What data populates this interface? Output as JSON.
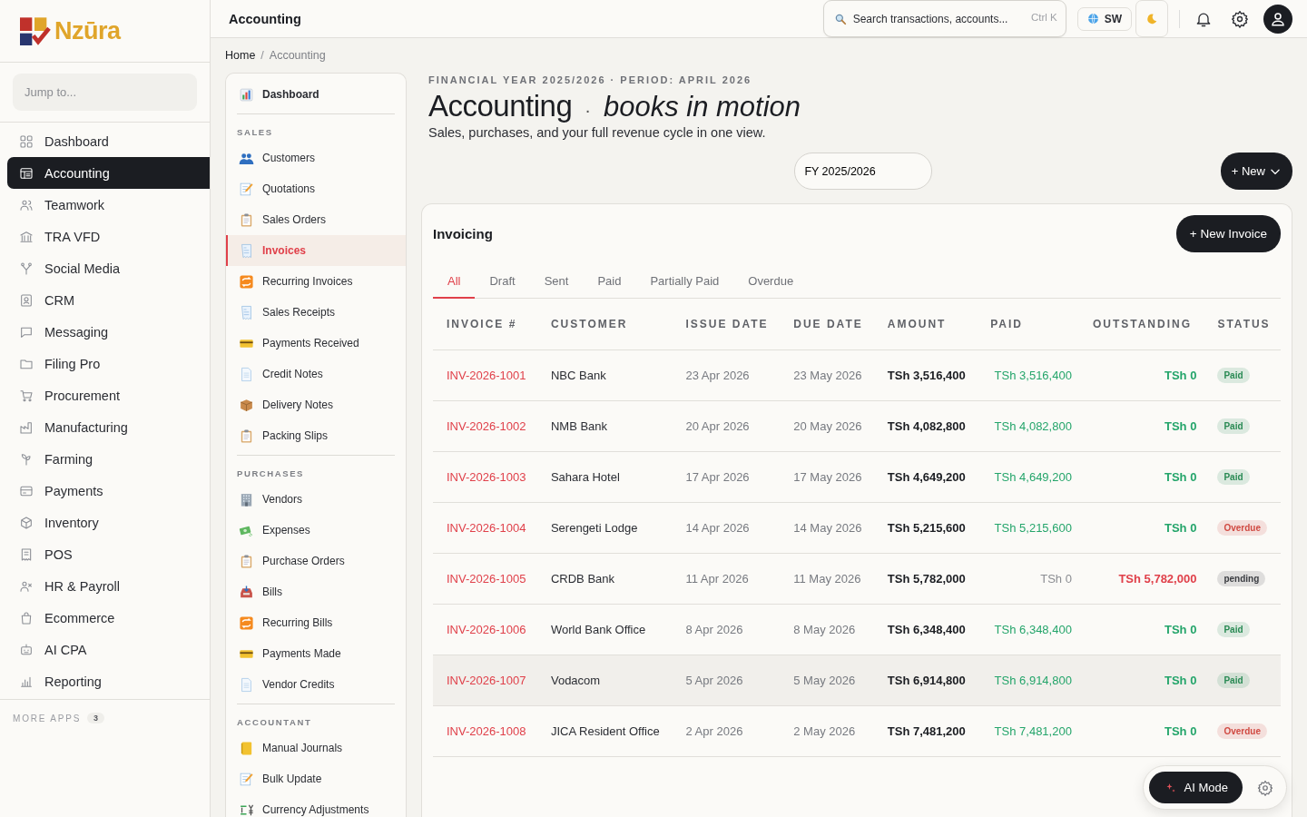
{
  "brand": {
    "name": "Nzūra"
  },
  "sidebar": {
    "search_placeholder": "Jump to...",
    "items": [
      {
        "label": "Dashboard",
        "selected": false
      },
      {
        "label": "Accounting",
        "selected": true
      },
      {
        "label": "Teamwork",
        "selected": false
      },
      {
        "label": "TRA VFD",
        "selected": false
      },
      {
        "label": "Social Media",
        "selected": false
      },
      {
        "label": "CRM",
        "selected": false
      },
      {
        "label": "Messaging",
        "selected": false
      },
      {
        "label": "Filing Pro",
        "selected": false
      },
      {
        "label": "Procurement",
        "selected": false
      },
      {
        "label": "Manufacturing",
        "selected": false
      },
      {
        "label": "Farming",
        "selected": false
      },
      {
        "label": "Payments",
        "selected": false
      },
      {
        "label": "Inventory",
        "selected": false
      },
      {
        "label": "POS",
        "selected": false
      },
      {
        "label": "HR & Payroll",
        "selected": false
      },
      {
        "label": "Ecommerce",
        "selected": false
      },
      {
        "label": "AI CPA",
        "selected": false
      },
      {
        "label": "Reporting",
        "selected": false
      }
    ],
    "more_apps": {
      "label": "MORE APPS",
      "count": "3"
    }
  },
  "header": {
    "title": "Accounting",
    "search_placeholder": "Search transactions, accounts...",
    "shortcut": "Ctrl K",
    "language": "SW"
  },
  "breadcrumb": {
    "items": [
      "Home",
      "Accounting"
    ],
    "separator": "/"
  },
  "subnav": {
    "top": {
      "label": "Dashboard",
      "selected": false
    },
    "sections": [
      {
        "title": "SALES",
        "items": [
          {
            "label": "Customers",
            "selected": false
          },
          {
            "label": "Quotations",
            "selected": false
          },
          {
            "label": "Sales Orders",
            "selected": false
          },
          {
            "label": "Invoices",
            "selected": true
          },
          {
            "label": "Recurring Invoices",
            "selected": false
          },
          {
            "label": "Sales Receipts",
            "selected": false
          },
          {
            "label": "Payments Received",
            "selected": false
          },
          {
            "label": "Credit Notes",
            "selected": false
          },
          {
            "label": "Delivery Notes",
            "selected": false
          },
          {
            "label": "Packing Slips",
            "selected": false
          }
        ]
      },
      {
        "title": "PURCHASES",
        "items": [
          {
            "label": "Vendors",
            "selected": false
          },
          {
            "label": "Expenses",
            "selected": false
          },
          {
            "label": "Purchase Orders",
            "selected": false
          },
          {
            "label": "Bills",
            "selected": false
          },
          {
            "label": "Recurring Bills",
            "selected": false
          },
          {
            "label": "Payments Made",
            "selected": false
          },
          {
            "label": "Vendor Credits",
            "selected": false
          }
        ]
      },
      {
        "title": "ACCOUNTANT",
        "items": [
          {
            "label": "Manual Journals",
            "selected": false
          },
          {
            "label": "Bulk Update",
            "selected": false
          },
          {
            "label": "Currency Adjustments",
            "selected": false
          }
        ]
      }
    ]
  },
  "page": {
    "eyebrow": "FINANCIAL YEAR 2025/2026 · PERIOD: APRIL 2026",
    "title": "Accounting",
    "separator": "·",
    "tagline": "books in motion",
    "subtitle": "Sales, purchases, and your full revenue cycle in one view.",
    "year_field": "FY 2025/2026",
    "new_button": "+ New"
  },
  "invoicing": {
    "title": "Invoicing",
    "new_button": "+ New Invoice",
    "tabs": [
      {
        "label": "All",
        "selected": true
      },
      {
        "label": "Draft",
        "selected": false
      },
      {
        "label": "Sent",
        "selected": false
      },
      {
        "label": "Paid",
        "selected": false
      },
      {
        "label": "Partially Paid",
        "selected": false
      },
      {
        "label": "Overdue",
        "selected": false
      }
    ],
    "columns": [
      "INVOICE #",
      "CUSTOMER",
      "ISSUE DATE",
      "DUE DATE",
      "AMOUNT",
      "PAID",
      "OUTSTANDING",
      "STATUS"
    ],
    "rows": [
      {
        "number": "INV-2026-1001",
        "customer": "NBC Bank",
        "issue": "23 Apr 2026",
        "due": "23 May 2026",
        "amount": "TSh 3,516,400",
        "paid": "TSh 3,516,400",
        "outstanding": "TSh 0",
        "outstanding_due": false,
        "status": {
          "label": "Paid",
          "color": "#2a8a54"
        },
        "highlighted": false
      },
      {
        "number": "INV-2026-1002",
        "customer": "NMB Bank",
        "issue": "20 Apr 2026",
        "due": "20 May 2026",
        "amount": "TSh 4,082,800",
        "paid": "TSh 4,082,800",
        "outstanding": "TSh 0",
        "outstanding_due": false,
        "status": {
          "label": "Paid",
          "color": "#2a8a54"
        },
        "highlighted": false
      },
      {
        "number": "INV-2026-1003",
        "customer": "Sahara Hotel",
        "issue": "17 Apr 2026",
        "due": "17 May 2026",
        "amount": "TSh 4,649,200",
        "paid": "TSh 4,649,200",
        "outstanding": "TSh 0",
        "outstanding_due": false,
        "status": {
          "label": "Paid",
          "color": "#2a8a54"
        },
        "highlighted": false
      },
      {
        "number": "INV-2026-1004",
        "customer": "Serengeti Lodge",
        "issue": "14 Apr 2026",
        "due": "14 May 2026",
        "amount": "TSh 5,215,600",
        "paid": "TSh 5,215,600",
        "outstanding": "TSh 0",
        "outstanding_due": false,
        "status": {
          "label": "Overdue",
          "color": "#d04a42"
        },
        "highlighted": false
      },
      {
        "number": "INV-2026-1005",
        "customer": "CRDB Bank",
        "issue": "11 Apr 2026",
        "due": "11 May 2026",
        "amount": "TSh 5,782,000",
        "paid": "TSh 0",
        "outstanding": "TSh 5,782,000",
        "outstanding_due": true,
        "status": {
          "label": "pending",
          "color": "#3b3d42"
        },
        "highlighted": false
      },
      {
        "number": "INV-2026-1006",
        "customer": "World Bank Office",
        "issue": "8 Apr 2026",
        "due": "8 May 2026",
        "amount": "TSh 6,348,400",
        "paid": "TSh 6,348,400",
        "outstanding": "TSh 0",
        "outstanding_due": false,
        "status": {
          "label": "Paid",
          "color": "#2a8a54"
        },
        "highlighted": false
      },
      {
        "number": "INV-2026-1007",
        "customer": "Vodacom",
        "issue": "5 Apr 2026",
        "due": "5 May 2026",
        "amount": "TSh 6,914,800",
        "paid": "TSh 6,914,800",
        "outstanding": "TSh 0",
        "outstanding_due": false,
        "status": {
          "label": "Paid",
          "color": "#2a8a54"
        },
        "highlighted": true
      },
      {
        "number": "INV-2026-1008",
        "customer": "JICA Resident Office",
        "issue": "2 Apr 2026",
        "due": "2 May 2026",
        "amount": "TSh 7,481,200",
        "paid": "TSh 7,481,200",
        "outstanding": "TSh 0",
        "outstanding_due": false,
        "status": {
          "label": "Overdue",
          "color": "#d04a42"
        },
        "highlighted": false
      }
    ]
  },
  "ai_widget": {
    "label": "AI Mode"
  }
}
